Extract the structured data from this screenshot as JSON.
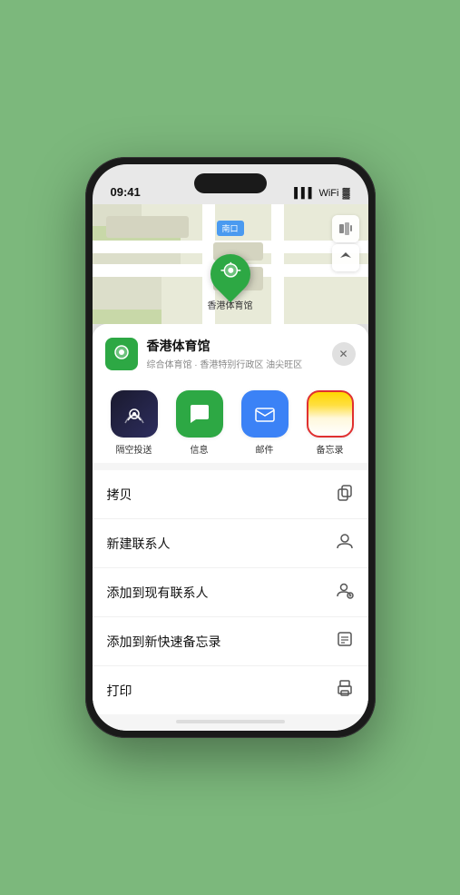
{
  "phone": {
    "time": "09:41",
    "map_label": "南口",
    "venue": {
      "name": "香港体育馆",
      "subtitle": "综合体育馆 · 香港特别行政区 油尖旺区",
      "pin_label": "香港体育馆"
    },
    "share_items": [
      {
        "id": "airdrop",
        "label": "隔空投送",
        "icon": "airdrop",
        "selected": false
      },
      {
        "id": "messages",
        "label": "信息",
        "icon": "msg",
        "selected": false
      },
      {
        "id": "mail",
        "label": "邮件",
        "icon": "mail",
        "selected": false
      },
      {
        "id": "notes",
        "label": "备忘录",
        "icon": "notes",
        "selected": true
      }
    ],
    "actions": [
      {
        "id": "copy",
        "label": "拷贝",
        "icon": "📋"
      },
      {
        "id": "new-contact",
        "label": "新建联系人",
        "icon": "👤"
      },
      {
        "id": "add-existing",
        "label": "添加到现有联系人",
        "icon": "👤"
      },
      {
        "id": "add-notes",
        "label": "添加到新快速备忘录",
        "icon": "📝"
      },
      {
        "id": "print",
        "label": "打印",
        "icon": "🖨"
      }
    ],
    "controls": {
      "map_btn": "🗺",
      "location_btn": "⬆"
    }
  }
}
